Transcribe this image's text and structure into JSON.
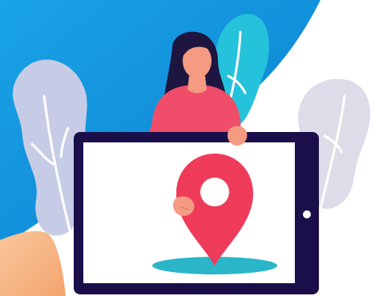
{
  "scene": {
    "subject": "woman-holding-tablet-with-location-pin",
    "colors": {
      "background": "#ffffff",
      "blue_sky": "#0a8fd8",
      "blue_sky_light": "#1aa3e6",
      "leaf_teal": "#25c2dc",
      "leaf_lavender": "#c7cce6",
      "leaf_gray": "#dcdde8",
      "tablet_frame": "#1a0f4a",
      "tablet_screen": "#ffffff",
      "pin_red": "#ef3b5a",
      "pin_shadow": "#2ab6c8",
      "shirt_pink": "#ef4d6a",
      "skin": "#f49b82",
      "hair": "#1e1640",
      "peach_corner": "#f7b98a"
    },
    "icons": [
      "location-pin-icon",
      "tablet-home-button"
    ]
  }
}
